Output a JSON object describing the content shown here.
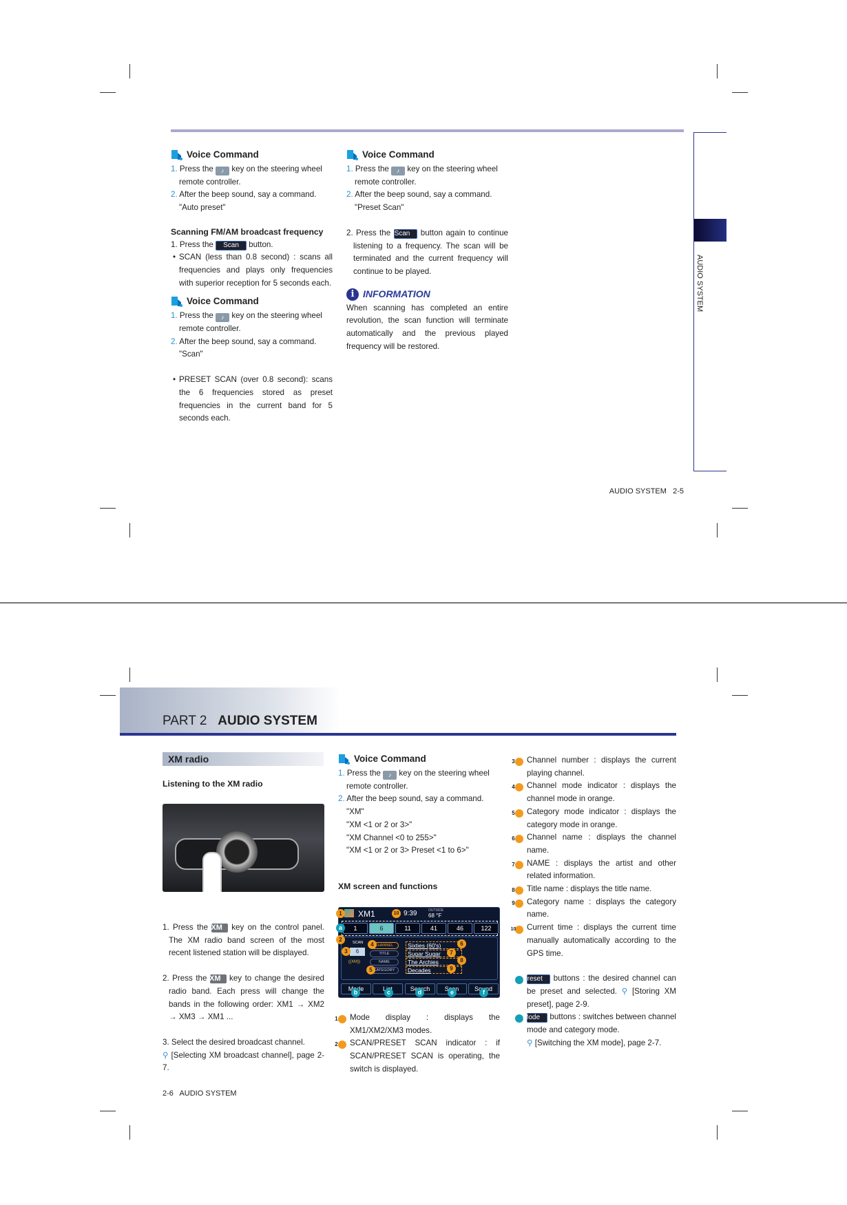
{
  "page_top": {
    "col1": {
      "voice1": {
        "title": "Voice Command",
        "s1_num": "1.",
        "s1_a": "Press the",
        "s1_b": "key on the steering wheel",
        "s1_c": "remote controller.",
        "s2_num": "2.",
        "s2": "After the beep sound, say a command.",
        "cmd": "\"Auto preset\""
      },
      "scan_heading": "Scanning FM/AM broadcast frequency",
      "scan_step_a": "1. Press the",
      "scan_button": "Scan",
      "scan_step_b": "button.",
      "scan_bullet": "SCAN (less than 0.8 second) : scans all frequencies and plays only frequencies with superior reception for 5 seconds each.",
      "voice2": {
        "title": "Voice Command",
        "s1_num": "1.",
        "s1_a": "Press the",
        "s1_b": "key on the steering wheel",
        "s1_c": "remote controller.",
        "s2_num": "2.",
        "s2": "After the beep sound, say a command.",
        "cmd": "\"Scan\""
      },
      "preset_bullet": "PRESET SCAN (over 0.8 second):  scans the 6 frequencies stored as preset frequencies in the current band for 5 seconds each."
    },
    "col2": {
      "voice": {
        "title": "Voice Command",
        "s1_num": "1.",
        "s1_a": "Press the",
        "s1_b": "key on the steering wheel",
        "s1_c": "remote controller.",
        "s2_num": "2.",
        "s2": "After the beep sound, say a command.",
        "cmd": "\"Preset Scan\""
      },
      "step2_a": "2. Press the",
      "scan_button": "Scan",
      "step2_b": "button again to continue listening to a frequency. The scan will be terminated and the current frequency will continue to be played.",
      "info_title": "INFORMATION",
      "info_text": "When scanning has completed an entire revolution, the scan function will terminate automatically and the previous played frequency will be restored."
    },
    "side_tab": "AUDIO SYSTEM",
    "footer": "AUDIO SYSTEM   2-5"
  },
  "page_bottom": {
    "header": {
      "part": "PART 2",
      "title": "AUDIO SYSTEM"
    },
    "section": "XM radio",
    "listening_heading": "Listening to the XM radio",
    "steps": [
      {
        "a": "1. Press the",
        "key": "XM",
        "b": "key on the control panel. The XM radio band screen of the most recent listened station will be displayed."
      },
      {
        "a": "2. Press the",
        "key": "XM",
        "b": "key to change the desired radio band. Each press will change the bands in the following order: XM1 → XM2 → XM3 → XM1 ..."
      },
      {
        "a": "3. Select the desired broadcast channel."
      }
    ],
    "step3_ref": "[Selecting XM broadcast channel], page 2-7.",
    "voice": {
      "title": "Voice Command",
      "s1_num": "1.",
      "s1_a": "Press the",
      "s1_b": "key on the steering wheel",
      "s1_c": "remote controller.",
      "s2_num": "2.",
      "s2": "After the beep sound, say a command.",
      "cmds": [
        "\"XM\"",
        "\"XM <1 or 2 or 3>\"",
        "\"XM Channel <0 to 255>\"",
        "\"XM <1 or 2 or 3> Preset <1 to 6>\""
      ]
    },
    "screen_heading": "XM screen and functions",
    "screen": {
      "mode": "XM1",
      "time": "9:39",
      "outside_label": "OUTSIDE",
      "outside_temp": "68 °F",
      "presets": [
        "1",
        "6",
        "11",
        "41",
        "46",
        "122"
      ],
      "active_preset": 1,
      "scan_label": "SCAN",
      "channel_number": "6",
      "xm_logo": "((XM))",
      "labels": [
        "CHANNEL",
        "TITLE",
        "NAME",
        "CATEGORY"
      ],
      "values": [
        "Sixties (60's)",
        "Sugar Sugar",
        "The Archies",
        "Decades"
      ],
      "softkeys": [
        "Mode",
        "List",
        "Search",
        "Scan",
        "Sound"
      ],
      "markers": [
        "1",
        "2",
        "3",
        "4",
        "5",
        "6",
        "7",
        "8",
        "9",
        "10"
      ],
      "letters": [
        "a",
        "b",
        "c",
        "d",
        "e",
        "f"
      ]
    },
    "callouts": [
      {
        "n": "1",
        "text": "Mode display : displays the XM1/XM2/XM3 modes."
      },
      {
        "n": "2",
        "text": "SCAN/PRESET SCAN indicator : if SCAN/PRESET SCAN is operating, the switch is displayed."
      },
      {
        "n": "3",
        "text": "Channel number : displays the current playing channel."
      },
      {
        "n": "4",
        "text": "Channel mode indicator : displays the channel mode in orange."
      },
      {
        "n": "5",
        "text": "Category mode indicator : displays the category mode in orange."
      },
      {
        "n": "6",
        "text": "Channel name : displays the channel name."
      },
      {
        "n": "7",
        "text": "NAME : displays the artist and other related information."
      },
      {
        "n": "8",
        "text": "Title name : displays the title name."
      },
      {
        "n": "9",
        "text": "Category name : displays the category name."
      },
      {
        "n": "10",
        "text": "Current time : displays the current time manually automatically according to the GPS time."
      }
    ],
    "letter_callouts": [
      {
        "l": "a",
        "btn": "Preset",
        "text": "buttons : the desired channel can be preset and selected.",
        "ref": "[Storing XM preset], page 2-9."
      },
      {
        "l": "b",
        "btn": "Mode",
        "text": "buttons : switches between channel mode and category mode.",
        "ref": "[Switching the XM mode], page 2-7."
      }
    ],
    "footer": "2-6   AUDIO SYSTEM"
  },
  "colors": {
    "accent_blue": "#2a3590",
    "step_number": "#2a8fd0",
    "marker_orange": "#f39a1c",
    "marker_teal": "#12a0b8",
    "top_rule": "#aaa8cc"
  }
}
